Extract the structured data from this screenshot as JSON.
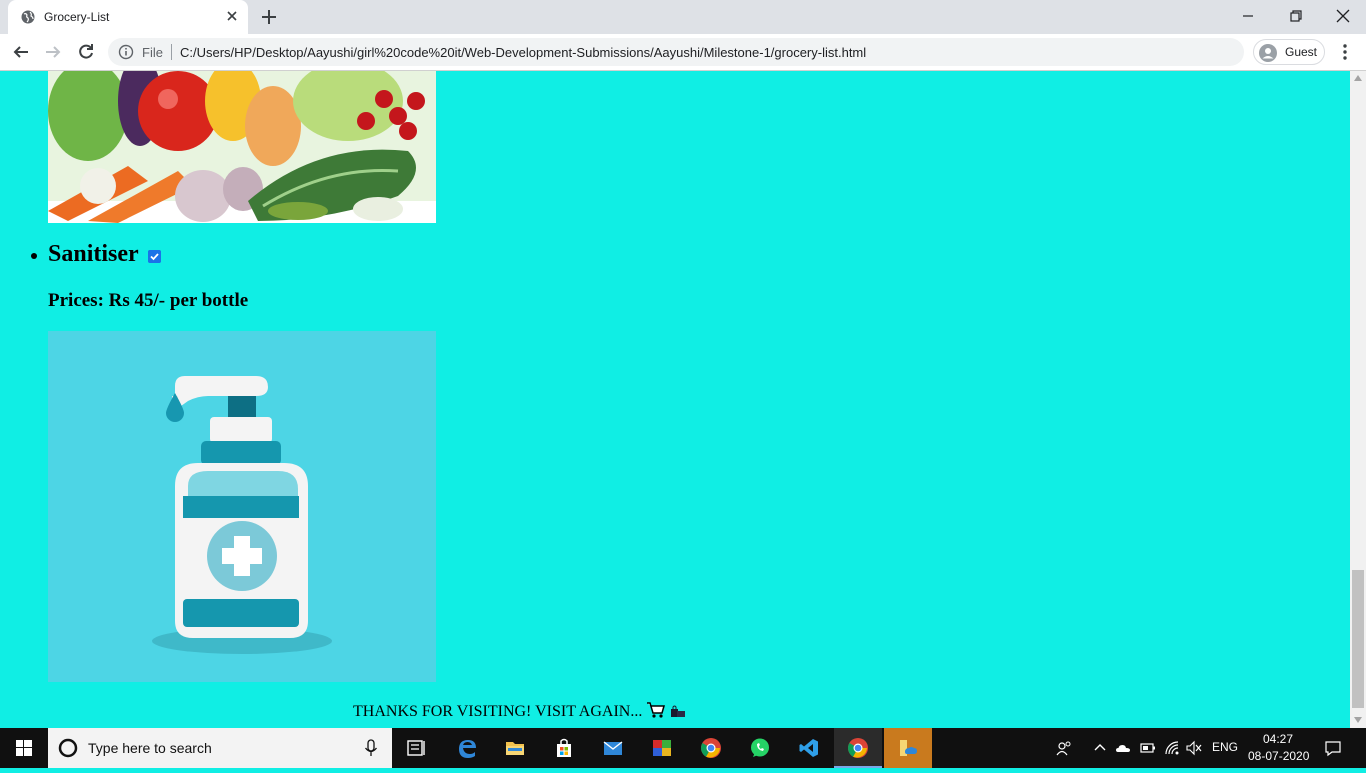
{
  "browser": {
    "tab_title": "Grocery-List",
    "scheme_label": "File",
    "url": "C:/Users/HP/Desktop/Aayushi/girl%20code%20it/Web-Development-Submissions/Aayushi/Milestone-1/grocery-list.html",
    "profile_label": "Guest"
  },
  "page": {
    "items": [
      {
        "name": "Sanitiser",
        "checked": true,
        "price": "Prices: Rs 45/- per bottle"
      }
    ],
    "footer": "THANKS FOR VISITING! VISIT AGAIN...",
    "footer_icons": [
      "shopping-cart-icon",
      "shopping-bags-icon"
    ],
    "background_color": "#10eee4"
  },
  "taskbar": {
    "search_placeholder": "Type here to search",
    "language": "ENG",
    "time": "04:27",
    "date": "08-07-2020",
    "pinned_apps": [
      "task-view",
      "edge",
      "file-explorer",
      "store",
      "mail",
      "winrar",
      "chrome",
      "whatsapp",
      "vscode",
      "chrome-active",
      "onedrive-folder"
    ]
  }
}
